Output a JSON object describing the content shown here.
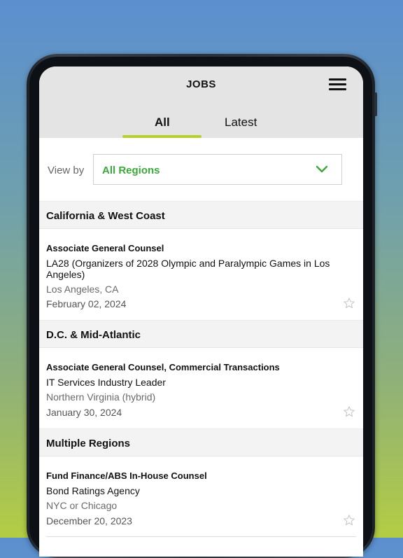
{
  "header": {
    "title": "JOBS",
    "tabs": [
      {
        "label": "All",
        "active": true
      },
      {
        "label": "Latest",
        "active": false
      }
    ]
  },
  "filter": {
    "label": "View by",
    "selected": "All Regions"
  },
  "sections": [
    {
      "title": "California & West Coast",
      "jobs": [
        {
          "title": "Associate General Counsel",
          "company": "LA28 (Organizers of 2028 Olympic and Paralympic Games in Los Angeles)",
          "location": "Los Angeles, CA",
          "date": "February 02, 2024"
        }
      ]
    },
    {
      "title": "D.C. & Mid-Atlantic",
      "jobs": [
        {
          "title": "Associate General Counsel, Commercial Transactions",
          "company": "IT Services Industry Leader",
          "location": "Northern Virginia (hybrid)",
          "date": "January 30, 2024"
        }
      ]
    },
    {
      "title": "Multiple Regions",
      "jobs": [
        {
          "title": "Fund Finance/ABS In-House Counsel",
          "company": "Bond Ratings Agency",
          "location": "NYC or Chicago",
          "date": "December 20, 2023"
        }
      ]
    }
  ],
  "colors": {
    "accent": "#b5d22b",
    "link_green": "#3aa83a",
    "header_bg": "#e4e4e4",
    "section_bg": "#f3f3f3"
  },
  "icons": {
    "menu": "hamburger-menu-icon",
    "dropdown": "chevron-down-icon",
    "favorite": "star-outline-icon"
  }
}
